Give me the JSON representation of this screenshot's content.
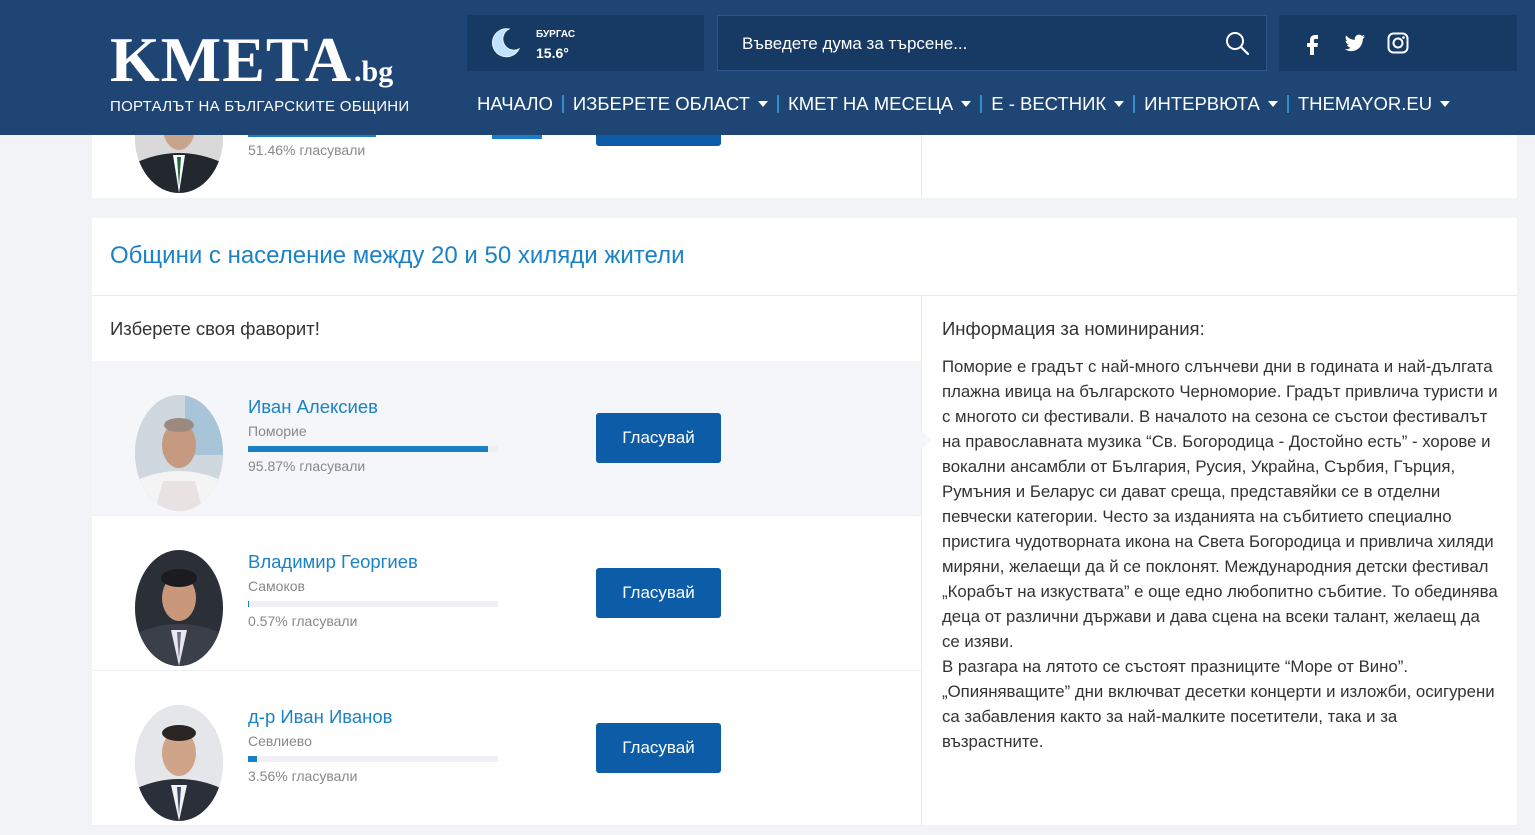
{
  "header": {
    "logo_main": "KMETA",
    "logo_tld": ".bg",
    "logo_sub": "ПОРТАЛЪТ НА БЪЛГАРСКИТЕ ОБЩИНИ",
    "weather": {
      "city": "БУРГАС",
      "temp": "15.6°",
      "icon": "moon-icon"
    },
    "search": {
      "placeholder": "Въведете дума за търсене..."
    },
    "social": [
      "facebook-icon",
      "twitter-icon",
      "instagram-icon"
    ],
    "nav": [
      {
        "label": "НАЧАЛО",
        "dropdown": false
      },
      {
        "label": "ИЗБЕРЕТЕ ОБЛАСТ",
        "dropdown": true
      },
      {
        "label": "КМЕТ НА МЕСЕЦА",
        "dropdown": true
      },
      {
        "label": "Е - ВЕСТНИК",
        "dropdown": true
      },
      {
        "label": "ИНТЕРВЮТА",
        "dropdown": true
      },
      {
        "label": "THEMAYOR.EU",
        "dropdown": true
      }
    ]
  },
  "top_card": {
    "percent_label": "51.46% гласували",
    "percent": 51.46
  },
  "section": {
    "title": "Общини с население между 20 и 50 хиляди жители",
    "choose_label": "Изберете своя фаворит!",
    "vote_label": "Гласувай",
    "candidates": [
      {
        "name": "Иван Алексиев",
        "town": "Поморие",
        "percent": 95.87,
        "percent_label": "95.87% гласували"
      },
      {
        "name": "Владимир Георгиев",
        "town": "Самоков",
        "percent": 0.57,
        "percent_label": "0.57% гласували"
      },
      {
        "name": "д-р Иван Иванов",
        "town": "Севлиево",
        "percent": 3.56,
        "percent_label": "3.56% гласували"
      }
    ],
    "info_title": "Информация за номинирания:",
    "info_text": "Поморие е градът с най-много слънчеви дни в годината и най-дългата плажна ивица на българското Черноморие. Градът привлича туристи и с многото си фестивали. В началото на сезона се състои фестивалът на православната музика “Св. Богородица - Достойно есть” - хорове и вокални ансамбли от България, Русия, Украйна, Сърбия, Гърция, Румъния и Беларус си дават среща, представяйки се в отделни певчески категории. Често за изданията на събитието специално пристига чудотворната икона на Света Богородица и привлича хиляди миряни, желаещи да й се поклонят. Международния детски фестивал „Корабът на изкуствата” е още едно любопитно събитие. То обединява деца от различни държави и дава сцена на всеки талант, желаещ да се изяви.\nВ разгара на лятото се състоят празниците “Море от Вино”. „Опияняващите” дни включват десетки концерти и изложби, осигурени са забавления както за най-малките посетители, така и за възрастните."
  },
  "colors": {
    "header": "#1e4573",
    "panel": "#163a63",
    "accent": "#1b82c5",
    "button": "#0d5ca8"
  }
}
